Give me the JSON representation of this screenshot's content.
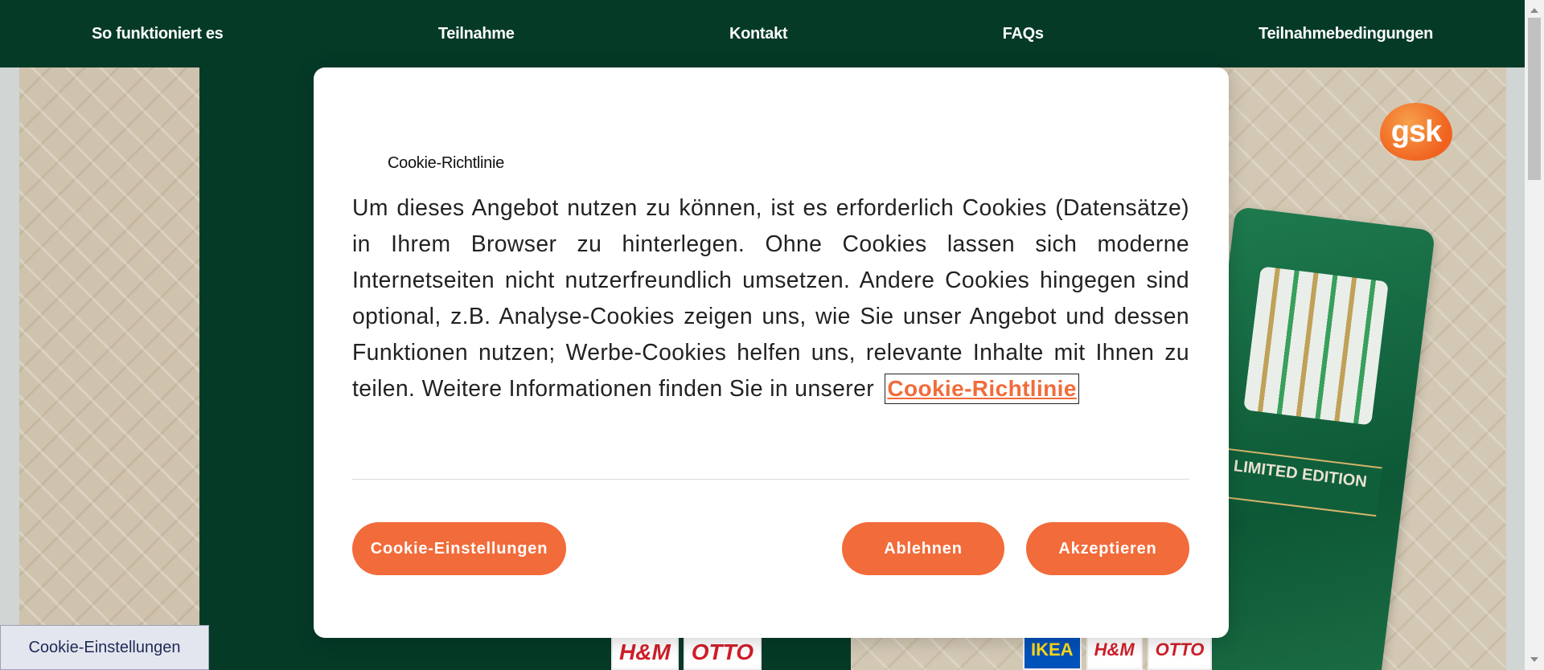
{
  "nav": {
    "items": [
      {
        "label": "So funktioniert es"
      },
      {
        "label": "Teilnahme"
      },
      {
        "label": "Kontakt"
      },
      {
        "label": "FAQs"
      },
      {
        "label": "Teilnahmebedingungen"
      }
    ]
  },
  "hero": {
    "logo_text": "gsk",
    "product_badge": "LIMITED EDITION",
    "stores": [
      "H&M",
      "OTTO",
      "IKEA",
      "H&M",
      "OTTO"
    ]
  },
  "cookie_modal": {
    "heading": "Cookie-Richtlinie",
    "body": "Um dieses Angebot nutzen zu können, ist es erforderlich Cookies (Datensätze) in Ihrem Browser zu hinterlegen. Ohne Cookies lassen sich moderne Internetseiten nicht nutzerfreundlich umsetzen. Andere Cookies hingegen sind optional, z.B. Analyse-Cookies zeigen uns, wie Sie unser Angebot und dessen Funktionen nutzen; Werbe-Cookies helfen uns, relevante Inhalte mit Ihnen zu teilen. Weitere Informationen finden Sie in unserer",
    "policy_link": "Cookie-Richtlinie",
    "buttons": {
      "settings": "Cookie-Einstellungen",
      "reject": "Ablehnen",
      "accept": "Akzeptieren"
    }
  },
  "cookie_tab": {
    "label": "Cookie-Einstellungen"
  },
  "colors": {
    "nav_bg": "#053a27",
    "accent": "#f26b3a",
    "link": "#f26b3a"
  }
}
